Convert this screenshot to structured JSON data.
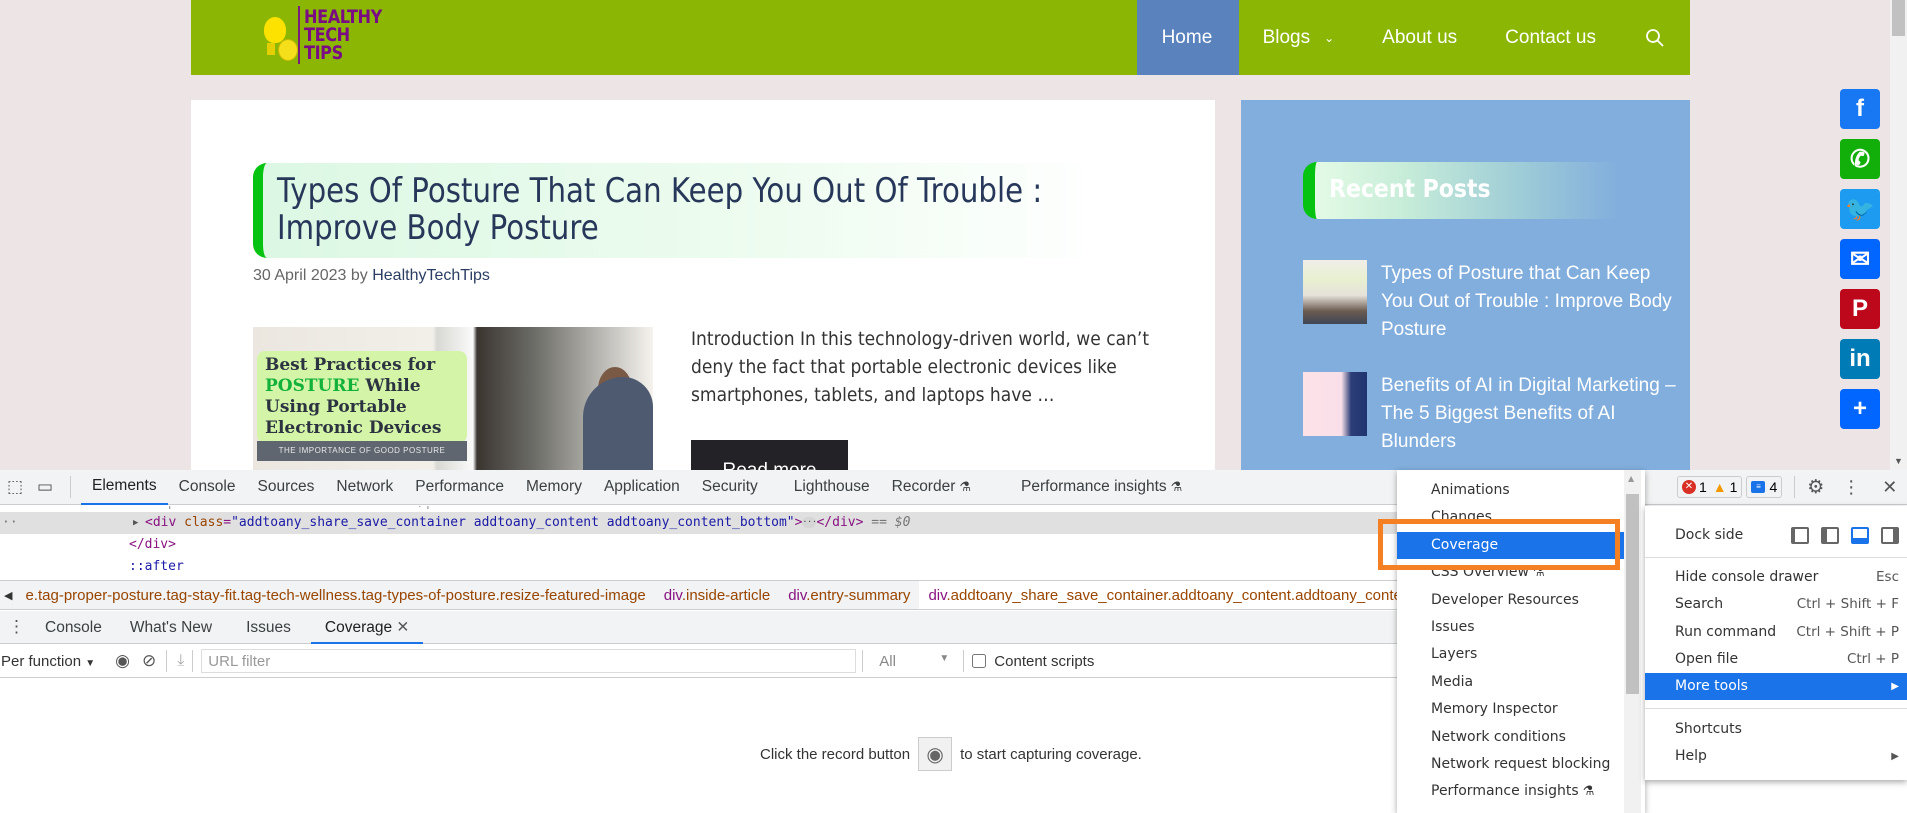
{
  "site": {
    "logo_lines": [
      "HEALTHY",
      "TECH",
      "TIPS"
    ],
    "nav": [
      {
        "label": "Home",
        "active": true
      },
      {
        "label": "Blogs",
        "has_dropdown": true
      },
      {
        "label": "About us"
      },
      {
        "label": "Contact us"
      }
    ],
    "search_icon": "search-icon"
  },
  "article": {
    "title": "Types Of Posture That Can Keep You Out Of Trouble : Improve Body Posture",
    "date": "30 April 2023",
    "by": "by",
    "author": "HealthyTechTips",
    "image": {
      "headline_1": "Best Practices for",
      "headline_green": "POSTURE",
      "headline_2": " While Using Portable Electronic Devices",
      "band": "THE IMPORTANCE OF GOOD POSTURE"
    },
    "excerpt": "Introduction In this technology-driven world, we can’t deny the fact that portable electronic devices like smartphones, tablets, and laptops have …",
    "read_more": "Read more"
  },
  "sidebar": {
    "title": "Recent Posts",
    "posts": [
      {
        "title": "Types of Posture that Can Keep You Out of Trouble : Improve Body Posture"
      },
      {
        "title": "Benefits of AI in Digital Marketing – The 5 Biggest Benefits of AI Blunders"
      }
    ]
  },
  "share": [
    {
      "name": "facebook",
      "glyph": "f",
      "color": "#1877f2"
    },
    {
      "name": "whatsapp",
      "glyph": "✆",
      "color": "#12af0a"
    },
    {
      "name": "twitter",
      "glyph": "🐦",
      "color": "#1d9bf0"
    },
    {
      "name": "email",
      "glyph": "✉",
      "color": "#0166ff"
    },
    {
      "name": "pinterest",
      "glyph": "P",
      "color": "#bd081c"
    },
    {
      "name": "linkedin",
      "glyph": "in",
      "color": "#007bb5"
    },
    {
      "name": "addtoany",
      "glyph": "+",
      "color": "#0166ff"
    }
  ],
  "devtools": {
    "tabs": [
      "Elements",
      "Console",
      "Sources",
      "Network",
      "Performance",
      "Memory",
      "Application",
      "Security",
      "Lighthouse",
      "Recorder",
      "Performance insights"
    ],
    "active_tab": "Elements",
    "dom": {
      "selected_open": "<div",
      "selected_attr": "class",
      "selected_value": "\"addtoany_share_save_container addtoany_content addtoany_content_bottom\"",
      "selected_close": "</div>",
      "selected_eq": "== $0",
      "line2": "</div>",
      "line3": "::after"
    },
    "breadcrumbs": [
      {
        "tag": "",
        "cls": "e.tag-proper-posture.tag-stay-fit.tag-tech-wellness.tag-types-of-posture.resize-featured-image"
      },
      {
        "tag": "div",
        "cls": ".inside-article"
      },
      {
        "tag": "div",
        "cls": ".entry-summary"
      },
      {
        "tag": "div",
        "cls": ".addtoany_share_save_container.addtoany_content.addtoany_conte",
        "selected": true
      }
    ],
    "status": {
      "errors": "1",
      "warnings": "1",
      "messages": "4"
    },
    "drawer_tabs": [
      "Console",
      "What's New",
      "Issues",
      "Coverage"
    ],
    "active_drawer_tab": "Coverage",
    "coverage": {
      "mode": "Per function",
      "url_filter_placeholder": "URL filter",
      "url_filter_value": "",
      "type_filter": "All",
      "content_scripts_label": "Content scripts",
      "content_scripts_checked": false,
      "message_before": "Click the record button",
      "message_after": "to start capturing coverage."
    },
    "more_tools_menu": {
      "items": [
        "Animations",
        "Changes",
        "Coverage",
        "CSS Overview",
        "Developer Resources",
        "Issues",
        "Layers",
        "Media",
        "Memory Inspector",
        "Network conditions",
        "Network request blocking",
        "Performance insights"
      ],
      "highlighted": "Coverage",
      "experimental": [
        "CSS Overview",
        "Performance insights"
      ]
    },
    "main_menu": {
      "dock_side_label": "Dock side",
      "items": [
        {
          "label": "Hide console drawer",
          "shortcut": "Esc"
        },
        {
          "label": "Search",
          "shortcut": "Ctrl + Shift + F"
        },
        {
          "label": "Run command",
          "shortcut": "Ctrl + Shift + P"
        },
        {
          "label": "Open file",
          "shortcut": "Ctrl + P"
        },
        {
          "label": "More tools",
          "shortcut": "▶",
          "highlighted": true
        },
        {
          "label": "Shortcuts",
          "shortcut": ""
        },
        {
          "label": "Help",
          "shortcut": "▶"
        }
      ]
    },
    "highlight_color": "#f48023",
    "accent_color": "#1a73e8"
  }
}
